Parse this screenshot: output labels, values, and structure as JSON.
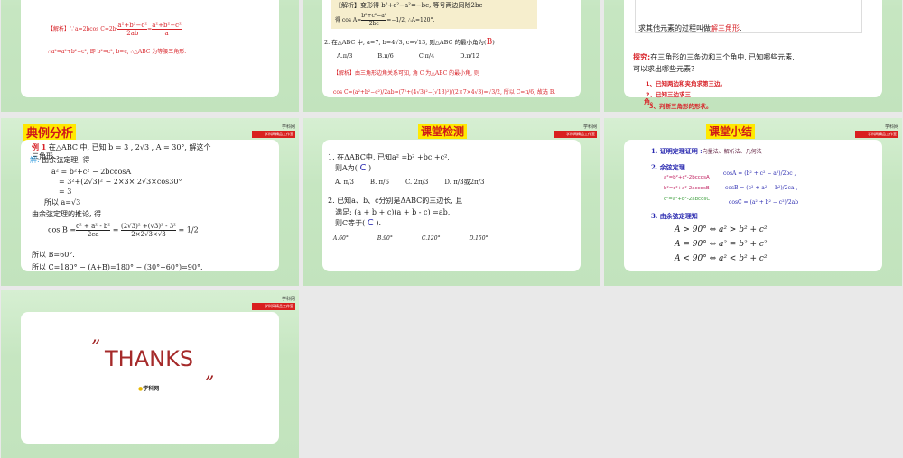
{
  "slides": [
    {
      "analysis_label": "【解析】",
      "line1_a": "∵a=2bcos C=2b·",
      "frac1_num": "a²+b²−c²",
      "frac1_den": "2ab",
      "eq": "=",
      "frac2_num": "a²+b²−c²",
      "frac2_den": "a",
      "line2": "∴a²=a²+b²−c², 即 b²=c², b=c, ∴△ABC 为等腰三角形."
    },
    {
      "analysis_top": "【解析】变形得 b²+c²−a²=−bc, 等号两边同除2bc",
      "cos_prefix": "得 cos A=",
      "cos_num": "b²+c²−a²",
      "cos_den": "2bc",
      "cos_result": "=−1/2, ∴A=120°.",
      "q2": "2. 在△ABC 中, a=7, b=4√3, c=√13, 则△ABC 的最小角为(",
      "q2_answer": "B",
      "q2_close": ")",
      "options": [
        "A.π/3",
        "B.π/6",
        "C.π/4",
        "D.π/12"
      ],
      "analysis2": "【解析】由三角形边角关系可知, 角 C 为△ABC 的最小角, 则",
      "cos_line": "cos C=(a²+b²−c²)/2ab=(7²+(4√3)²−(√13)²)/(2×7×4√3)=√3/2, 所以 C=π/6, 故选 B."
    },
    {
      "top_line_a": "求其他元素的过程叫做",
      "top_line_b": "解三角形",
      "top_line_c": ".",
      "explore_label": "探究:",
      "explore_text": "在三角形的三条边和三个角中, 已知哪些元素,",
      "explore_text2": "可以求出哪些元素?",
      "items": [
        "1、已知两边和夹角求第三边。",
        "2、已知三边求三",
        "角。",
        "3、判断三角形的形状。"
      ]
    },
    {
      "title": "典例分析",
      "ex_label": "例 1",
      "ex_text": "在△ABC 中, 已知 b = 3 , 2√3 ,  A = 30°, 解这个",
      "ex_text2": "三角形",
      "sol_label": "解:",
      "sol1": "由余弦定理, 得",
      "l1": "a² = b²+c² − 2bccosA",
      "l2": "= 3²+(2√3)² − 2×3× 2√3×cos30°",
      "l3": "= 3",
      "l4": "所以   a=√3",
      "l5": "由余弦定理的推论, 得",
      "cosb_prefix": "cos B =",
      "cosb_num": "c² + a² - b²",
      "cosb_den": "2ca",
      "cosb_num2": "(2√3)² +(√3)² - 3²",
      "cosb_den2": "2×2√3×√3",
      "cosb_res": "= 1/2",
      "l6": "所以 B=60°.",
      "l7": "所以 C=180° − (A+B)=180° − (30°+60°)=90°."
    },
    {
      "title": "课堂检测",
      "q1": "1. 在ΔABC中, 已知a² =b² +bc +c²,",
      "q1b": "则A为(",
      "q1_ans": "C",
      "q1c": ")",
      "q1_opts": [
        "A. π/3",
        "B. π/6",
        "C. 2π/3",
        "D. π/3或2π/3"
      ],
      "q2": "2. 已知a、b、c分别是ΔABC的三边长, 且",
      "q2b": "满足: (a + b + c)(a + b - c) =ab,",
      "q2c": "则C等于(",
      "q2_ans": "C",
      "q2d": ").",
      "q2_opts": [
        "A.60°",
        "B.90°",
        "C.120°",
        "D.150°"
      ]
    },
    {
      "title": "课堂小结",
      "p1": "1. 证明定理证明 :",
      "p1b": "向量法、解析法、几何法",
      "p2": "2. 余弦定理",
      "f1": "a²=b²+c²-2bccosA",
      "f2": "b²=c²+a²-2accosB",
      "f3": "c²=a²+b²-2abcosC",
      "c1": "cosA = (b² + c² − a²)/2bc ,",
      "c2": "cosB = (c² + a² − b²)/2ca ,",
      "c3": "cosC = (a² + b² − c²)/2ab",
      "p3": "3. 由余弦定理知",
      "r1": "A > 90° ⇔ a² > b² + c²",
      "r2": "A = 90° ⇔ a² = b² + c²",
      "r3": "A < 90° ⇔ a² < b² + c²"
    },
    {
      "thanks": "THANKS",
      "quote_open": "”",
      "quote_close": "”",
      "brand": "学科网"
    }
  ],
  "logo": {
    "name": "学科网",
    "tag": "学科网精品工作室"
  },
  "colors": {
    "accent_red": "#d8242a",
    "title_yellow": "#ffe800",
    "slide_green": "#c6e6c1"
  }
}
